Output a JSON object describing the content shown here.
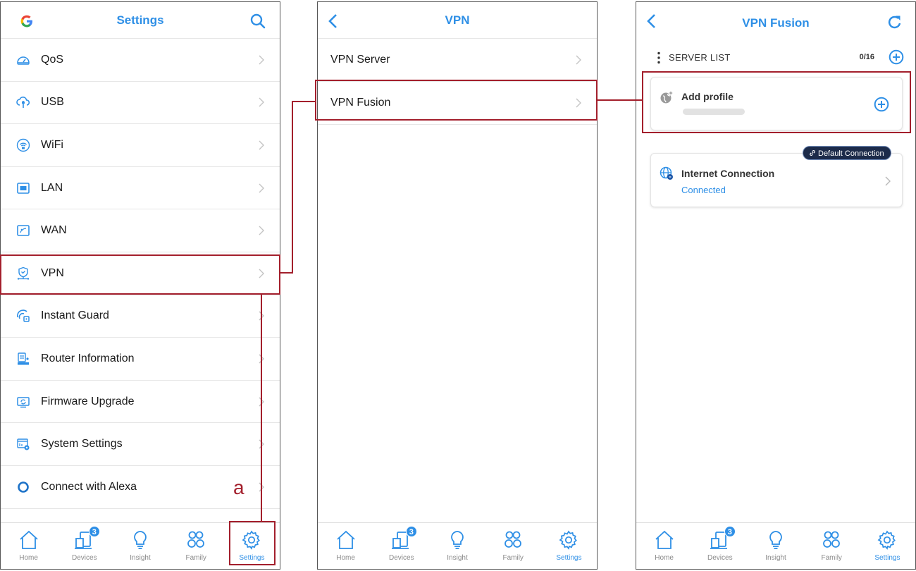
{
  "screen1": {
    "title": "Settings",
    "items": [
      {
        "label": "QoS"
      },
      {
        "label": "USB"
      },
      {
        "label": "WiFi"
      },
      {
        "label": "LAN"
      },
      {
        "label": "WAN"
      },
      {
        "label": "VPN"
      },
      {
        "label": "Instant Guard"
      },
      {
        "label": "Router Information"
      },
      {
        "label": "Firmware Upgrade"
      },
      {
        "label": "System Settings"
      },
      {
        "label": "Connect with Alexa"
      }
    ]
  },
  "screen2": {
    "title": "VPN",
    "items": [
      {
        "label": "VPN Server"
      },
      {
        "label": "VPN Fusion"
      }
    ]
  },
  "screen3": {
    "title": "VPN Fusion",
    "server_list_label": "SERVER LIST",
    "server_count": "0/16",
    "add_profile_label": "Add profile",
    "internet_title": "Internet Connection",
    "internet_status": "Connected",
    "default_badge": "Default Connection"
  },
  "tabbar": {
    "home": "Home",
    "devices": "Devices",
    "devices_badge": "3",
    "insight": "Insight",
    "family": "Family",
    "settings": "Settings"
  },
  "annotation_letter": "a",
  "colors": {
    "accent": "#2e8fe6",
    "highlight": "#a31f2c",
    "pill_bg": "#1c2b4a"
  }
}
